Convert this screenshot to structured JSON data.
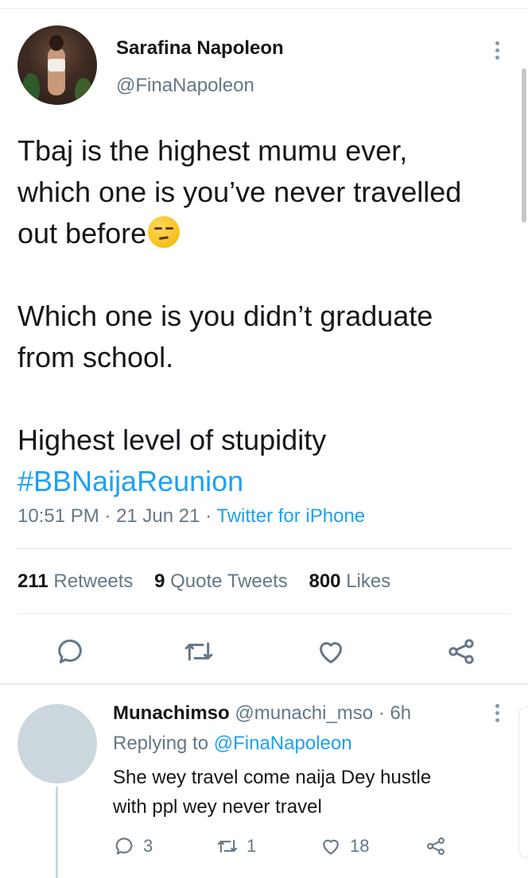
{
  "tweet": {
    "author_name": "Sarafina Napoleon",
    "author_handle": "@FinaNapoleon",
    "text_lines": [
      "Tbaj is the highest mumu ever,",
      "which one is you’ve never travelled",
      "out before"
    ],
    "text_lines_2": [
      "Which one is you didn’t graduate",
      "from school."
    ],
    "text_line_3": "Highest level of stupidity",
    "hashtag": "#BBNaijaReunion",
    "emoji": "unamused-face",
    "time": "10:51 PM",
    "date": "21 Jun 21",
    "source": "Twitter for iPhone",
    "meta_separator": " · "
  },
  "stats": {
    "retweets_count": "211",
    "retweets_label": "Retweets",
    "quote_count": "9",
    "quote_label": "Quote Tweets",
    "likes_count": "800",
    "likes_label": "Likes"
  },
  "actions": {
    "icons": [
      "reply-icon",
      "retweet-icon",
      "like-icon",
      "share-icon"
    ],
    "icon_color": "#657786"
  },
  "reply": {
    "name": "Munachimso",
    "handle": "@munachi_mso",
    "time": "· 6h",
    "replying_prefix": "Replying to",
    "replying_to": "@FinaNapoleon",
    "text_lines": [
      "She wey travel come naija Dey hustle",
      "with ppl wey never travel"
    ],
    "reply_count": "3",
    "retweet_count": "1",
    "like_count": "18"
  },
  "colors": {
    "accent": "#1da1f2",
    "secondary_text": "#657786",
    "primary_text": "#14171a"
  }
}
